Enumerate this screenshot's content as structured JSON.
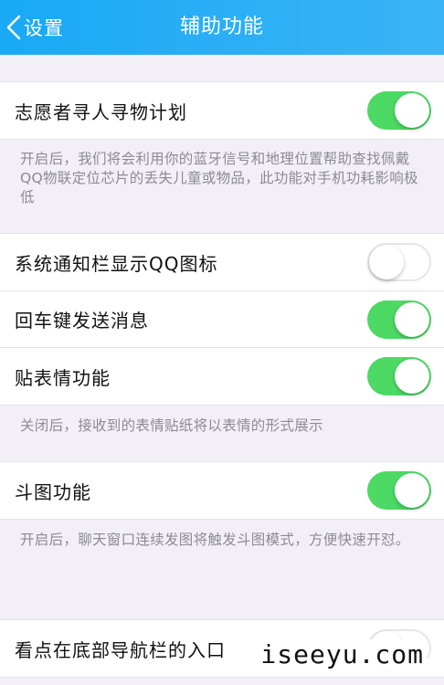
{
  "navbar": {
    "back_label": "设置",
    "title": "辅助功能",
    "color": "#19a9f5"
  },
  "settings": [
    {
      "label": "志愿者寻人寻物计划",
      "enabled": true,
      "description": "开启后，我们将会利用你的蓝牙信号和地理位置帮助查找佩戴QQ物联定位芯片的丢失儿童或物品，此功能对手机功耗影响极低"
    },
    {
      "label": "系统通知栏显示QQ图标",
      "enabled": false
    },
    {
      "label": "回车键发送消息",
      "enabled": true
    },
    {
      "label": "贴表情功能",
      "enabled": true,
      "description": "关闭后，接收到的表情贴纸将以表情的形式展示"
    },
    {
      "label": "斗图功能",
      "enabled": true,
      "description": "开启后，聊天窗口连续发图将触发斗图模式，方便快速开怼。"
    },
    {
      "label": "看点在底部导航栏的入口",
      "enabled": false
    }
  ],
  "watermark": "iseeyu.com",
  "colors": {
    "toggle_on": "#4cd964",
    "background": "#f2f0f6"
  }
}
